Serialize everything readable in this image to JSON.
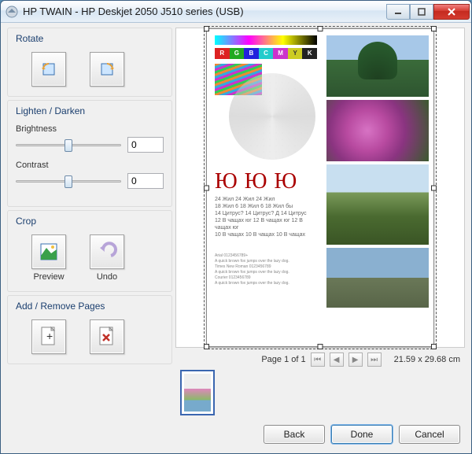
{
  "window": {
    "title": "HP TWAIN - HP Deskjet 2050 J510 series (USB)"
  },
  "rotate": {
    "title": "Rotate"
  },
  "lighten": {
    "title": "Lighten / Darken",
    "brightness_label": "Brightness",
    "brightness_value": "0",
    "contrast_label": "Contrast",
    "contrast_value": "0"
  },
  "crop": {
    "title": "Crop",
    "preview_label": "Preview",
    "undo_label": "Undo"
  },
  "pages": {
    "title": "Add / Remove Pages"
  },
  "pager": {
    "text": "Page 1 of 1",
    "dimensions": "21.59 x 29.68 cm"
  },
  "scan": {
    "rgb_labels": [
      "R",
      "G",
      "B",
      "C",
      "M",
      "Y",
      "K"
    ],
    "big": "Ю Ю Ю",
    "lines": "24 Жил   24 Жил   24 Жил\n18 Жил 6  18 Жил 6  18 Жил бы\n14 Цитрус?  14 Цитрус?  Д 14 Цитрус\n12 В чащах юг  12 В чащах юг  12 В чащах юг\n10 В чащах    10 В чащах    10 В чащах",
    "tiny": "Arial 0123456789+\nA quick brown fox jumps over the lazy dog.\nTimes New Roman 0123456789\nA quick brown fox jumps over the lazy dog.\nCourier 0123456789\nA quick brown fox jumps over the lazy dog."
  },
  "footer": {
    "back": "Back",
    "done": "Done",
    "cancel": "Cancel"
  }
}
